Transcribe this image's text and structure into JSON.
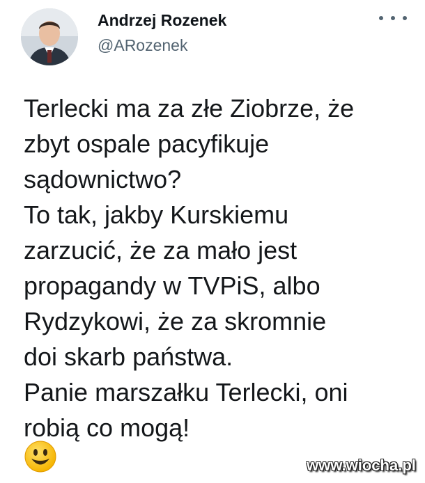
{
  "tweet": {
    "author_name": "Andrzej Rozenek",
    "author_handle": "@ARozenek",
    "more_icon": "more-horizontal-icon",
    "lines": [
      "Terlecki ma za złe Ziobrze, że",
      "zbyt ospale pacyfikuje",
      "sądownictwo?",
      "To tak, jakby Kurskiemu",
      "zarzucić, że za mało jest",
      "propagandy w TVPiS, albo",
      "Rydzykowi, że za skromnie",
      "doi skarb państwa.",
      "Panie marszałku Terlecki, oni",
      "robią co mogą!"
    ],
    "emoji": "smiling-face-icon"
  },
  "watermark": {
    "text": "www.wiocha.pl"
  },
  "colors": {
    "text": "#14171a",
    "handle": "#536471",
    "emoji_yellow": "#ffcc33"
  }
}
